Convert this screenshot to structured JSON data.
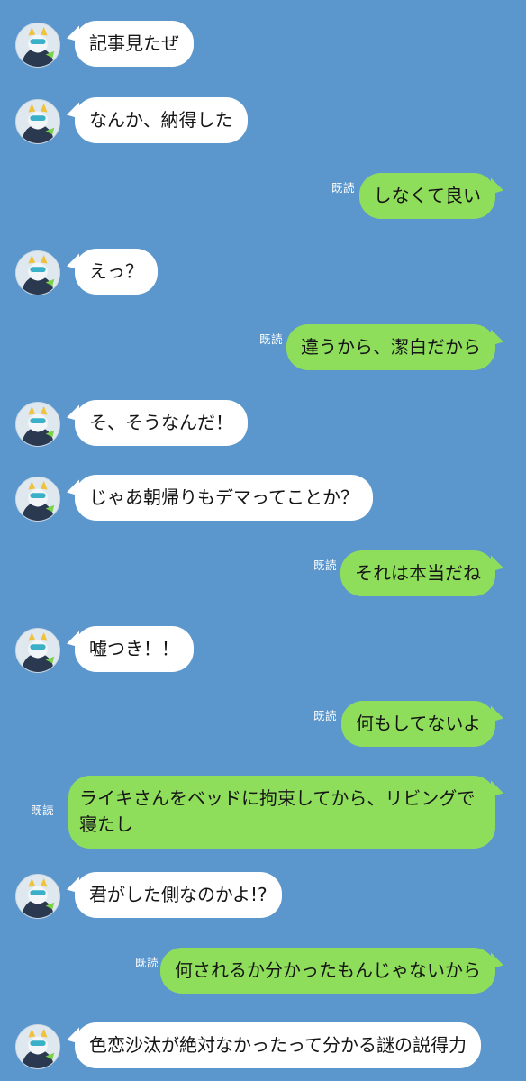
{
  "read_label": "既読",
  "colors": {
    "background": "#5b97cc",
    "incoming_bubble": "#ffffff",
    "outgoing_bubble": "#8fde5b",
    "read_text": "#ffffff"
  },
  "messages": [
    {
      "side": "incoming",
      "text": "記事見たぜ"
    },
    {
      "side": "incoming",
      "text": "なんか、納得した"
    },
    {
      "side": "outgoing",
      "text": "しなくて良い",
      "read": "既読"
    },
    {
      "side": "incoming",
      "text": "えっ？"
    },
    {
      "side": "outgoing",
      "text": "違うから、潔白だから",
      "read": "既読"
    },
    {
      "side": "incoming",
      "text": "そ、そうなんだ！"
    },
    {
      "side": "incoming",
      "text": "じゃあ朝帰りもデマってことか？"
    },
    {
      "side": "outgoing",
      "text": "それは本当だね",
      "read": "既読"
    },
    {
      "side": "incoming",
      "text": "嘘つき！！"
    },
    {
      "side": "outgoing",
      "text": "何もしてないよ",
      "read": "既読"
    },
    {
      "side": "outgoing",
      "text": "ライキさんをベッドに拘束してから、リビングで寝たし",
      "read": "既読"
    },
    {
      "side": "incoming",
      "text": "君がした側なのかよ!?"
    },
    {
      "side": "outgoing",
      "text": "何されるか分かったもんじゃないから",
      "read": "既読"
    },
    {
      "side": "incoming",
      "text": "色恋沙汰が絶対なかったって分かる謎の説得力"
    }
  ]
}
